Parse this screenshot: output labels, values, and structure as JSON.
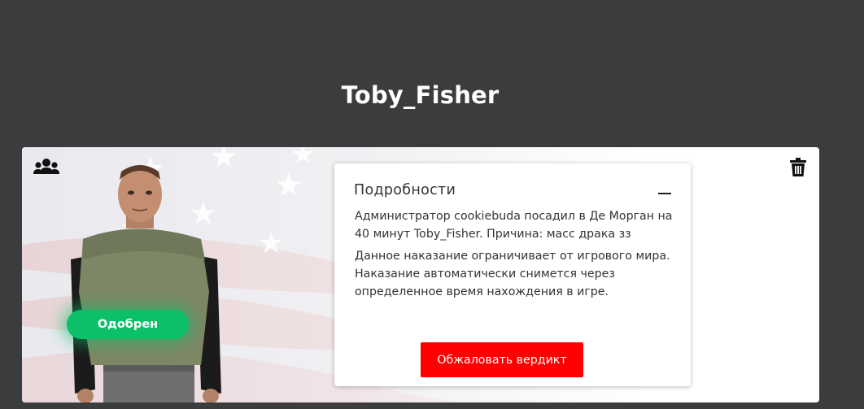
{
  "profile": {
    "name": "Toby_Fisher"
  },
  "card": {
    "status_label": "Одобрен",
    "icons": {
      "group": "users-group-icon",
      "delete": "trash-icon"
    },
    "colors": {
      "status": "#0cc06a",
      "appeal": "#ff0000",
      "background": "#3b3c3e"
    }
  },
  "details": {
    "title": "Подробности",
    "collapse_icon": "minus-icon",
    "punishment_text": "Администратор cookiebuda посадил в Де Морган на 40 минут Toby_Fisher. Причина: масс драка зз",
    "info_text": "Данное наказание ограничивает от игрового мира. Наказание автоматически снимется через определенное время нахождения в игре.",
    "appeal_button": "Обжаловать вердикт"
  }
}
